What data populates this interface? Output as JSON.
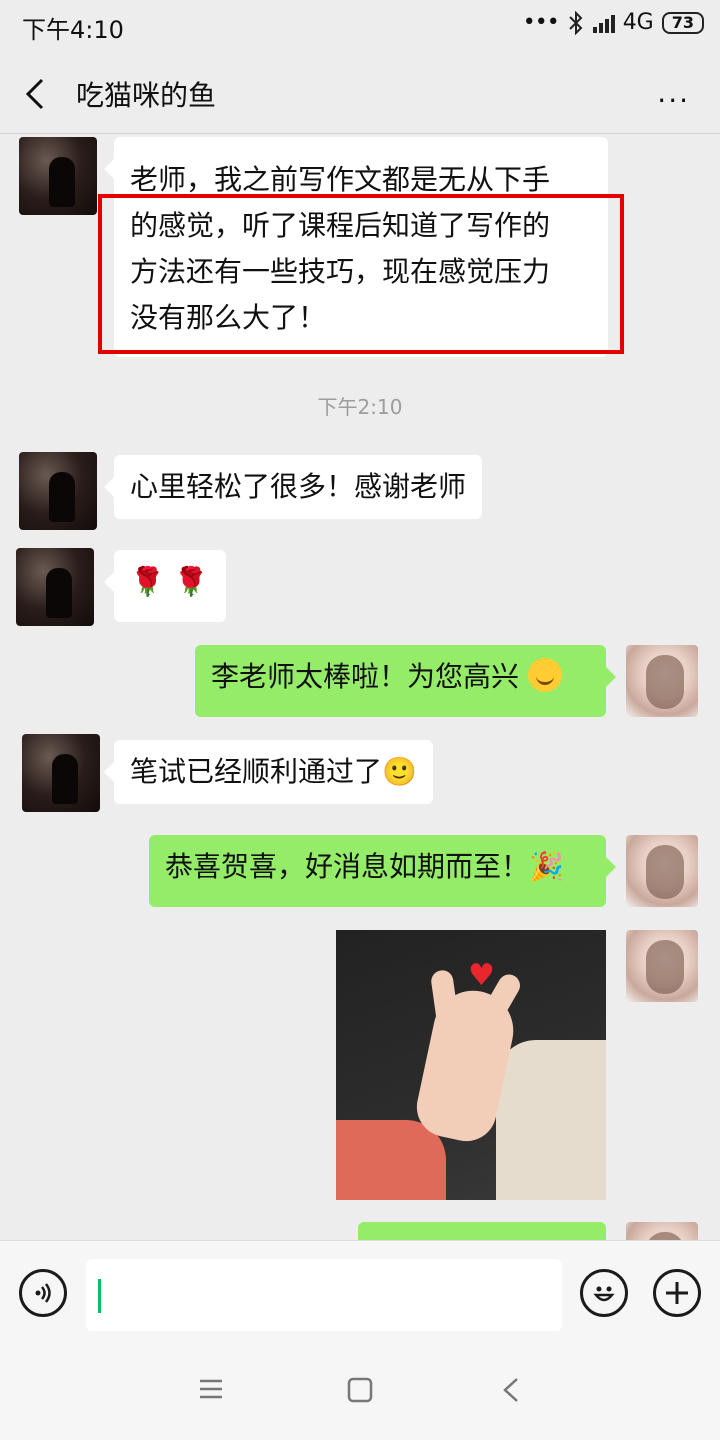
{
  "status_bar": {
    "time": "下午4:10",
    "dots": "•••",
    "network": "4G",
    "battery": "73"
  },
  "header": {
    "title": "吃猫咪的鱼",
    "more": "..."
  },
  "messages": [
    {
      "side": "left",
      "text_lines": [
        "老师，我之前写作文都是无从下手",
        "的感觉，听了课程后知道了写作的",
        "方法还有一些技巧，现在感觉压力",
        "没有那么大了！"
      ],
      "highlighted": true
    },
    {
      "side": "left",
      "text": "心里轻松了很多！感谢老师"
    },
    {
      "side": "left",
      "text": "🌹 🌹"
    },
    {
      "side": "right",
      "text": "李老师太棒啦！为您高兴"
    },
    {
      "side": "left",
      "text": "笔试已经顺利通过了🙂"
    },
    {
      "side": "right",
      "text": "恭喜贺喜，好消息如期而至！🎉"
    }
  ],
  "timestamp": "下午2:10",
  "colors": {
    "sent_bubble": "#95ec69",
    "received_bubble": "#ffffff",
    "highlight_box": "#e50000",
    "background": "#ededed"
  }
}
